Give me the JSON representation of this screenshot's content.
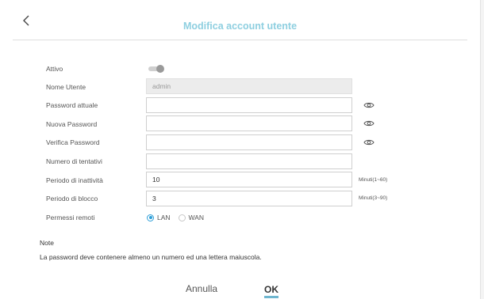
{
  "header": {
    "title": "Modifica account utente",
    "back_icon": "chevron-left-icon"
  },
  "form": {
    "active_label": "Attivo",
    "active_state": false,
    "username_label": "Nome Utente",
    "username_value": "admin",
    "current_password_label": "Password attuale",
    "current_password_value": "",
    "new_password_label": "Nuova Password",
    "new_password_value": "",
    "verify_password_label": "Verifica Password",
    "verify_password_value": "",
    "attempts_label": "Numero di tentativi",
    "attempts_value": "",
    "inactivity_label": "Periodo di inattività",
    "inactivity_value": "10",
    "inactivity_unit": "Minuti(1~60)",
    "lock_label": "Periodo di blocco",
    "lock_value": "3",
    "lock_unit": "Minuti(3~90)",
    "remote_label": "Permessi remoti",
    "remote_options": [
      "LAN",
      "WAN"
    ],
    "remote_selected": "LAN",
    "eye_icon": "eye-icon"
  },
  "note": {
    "title": "Note",
    "text": "La password deve contenere almeno un numero ed una lettera maiuscola."
  },
  "actions": {
    "cancel_label": "Annulla",
    "ok_label": "OK"
  },
  "colors": {
    "accent": "#2f9fd8",
    "title": "#8ecfe0",
    "ok_underline": "#6fb6cf"
  }
}
